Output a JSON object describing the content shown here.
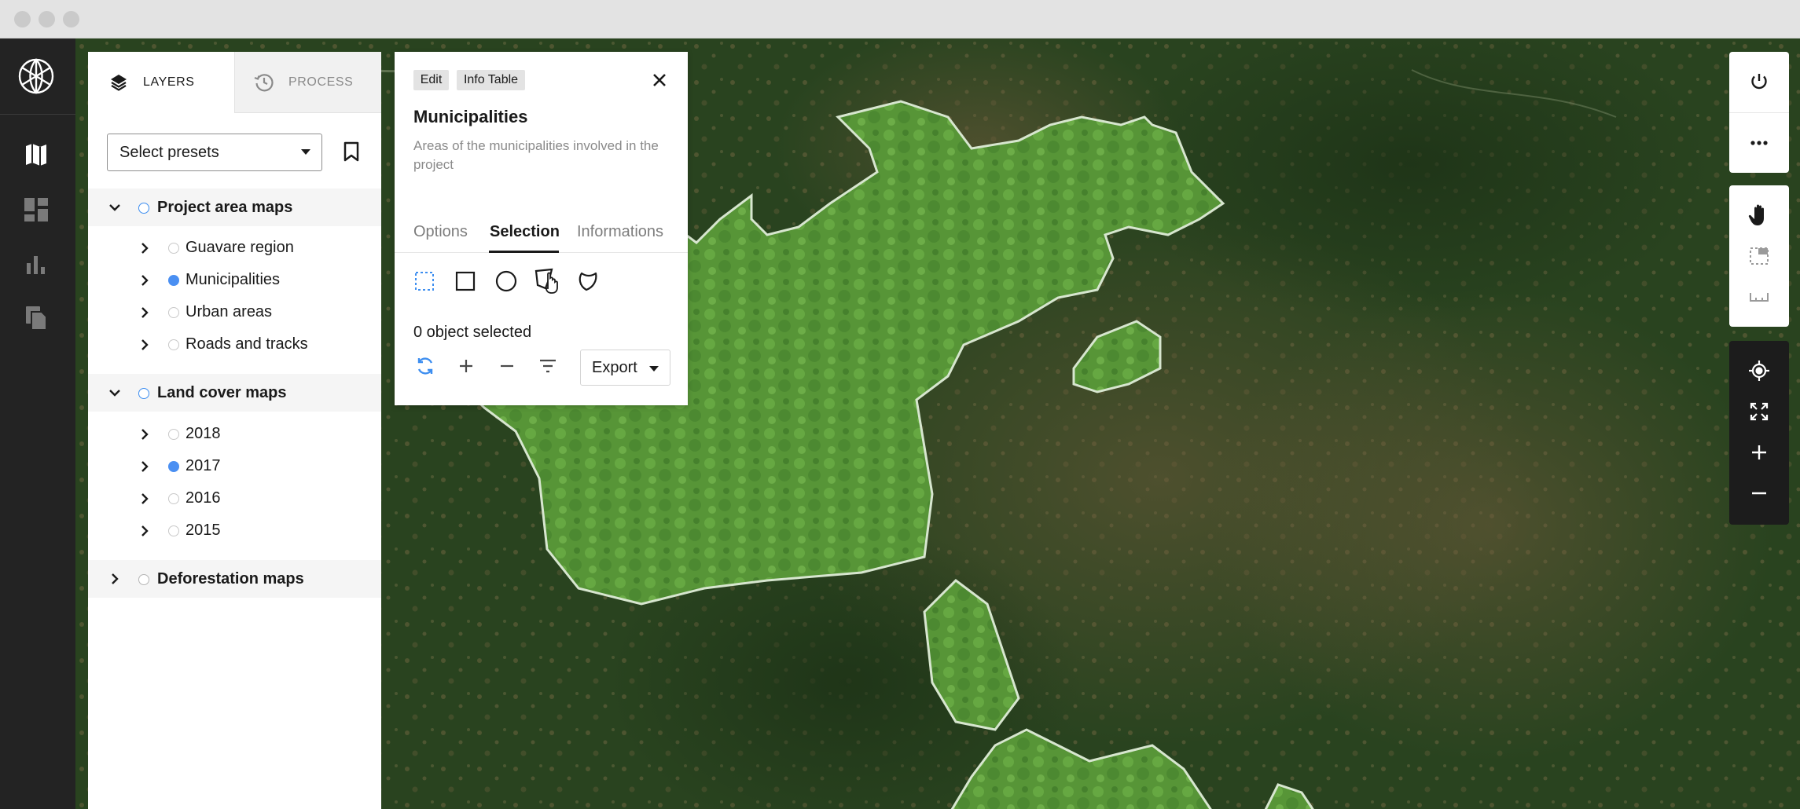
{
  "panel_tabs": [
    {
      "label": "LAYERS",
      "icon": "layers-icon"
    },
    {
      "label": "PROCESS",
      "icon": "process-history-icon"
    }
  ],
  "presets": {
    "value": "Select presets"
  },
  "groups": [
    {
      "label": "Project area maps",
      "expanded": true,
      "items": [
        {
          "label": "Guavare region",
          "selected": false
        },
        {
          "label": "Municipalities",
          "selected": true
        },
        {
          "label": "Urban areas",
          "selected": false
        },
        {
          "label": "Roads and tracks",
          "selected": false
        }
      ]
    },
    {
      "label": "Land cover maps",
      "expanded": true,
      "items": [
        {
          "label": "2018",
          "selected": false
        },
        {
          "label": "2017",
          "selected": true
        },
        {
          "label": "2016",
          "selected": false
        },
        {
          "label": "2015",
          "selected": false
        }
      ]
    },
    {
      "label": "Deforestation maps",
      "expanded": false,
      "items": []
    }
  ],
  "detail": {
    "badges": [
      "Edit",
      "Info Table"
    ],
    "title": "Municipalities",
    "description": "Areas of the municipalities involved in the project",
    "tabs": [
      "Options",
      "Selection",
      "Informations"
    ],
    "active_tab": "Selection",
    "selection_count": "0 object selected",
    "export_label": "Export"
  },
  "colors": {
    "accent": "#3d8ef0",
    "rail": "#232323",
    "map_dark": "#27401f",
    "region_fill": "#5f9c3e",
    "region_outline": "#d7e6cf"
  }
}
